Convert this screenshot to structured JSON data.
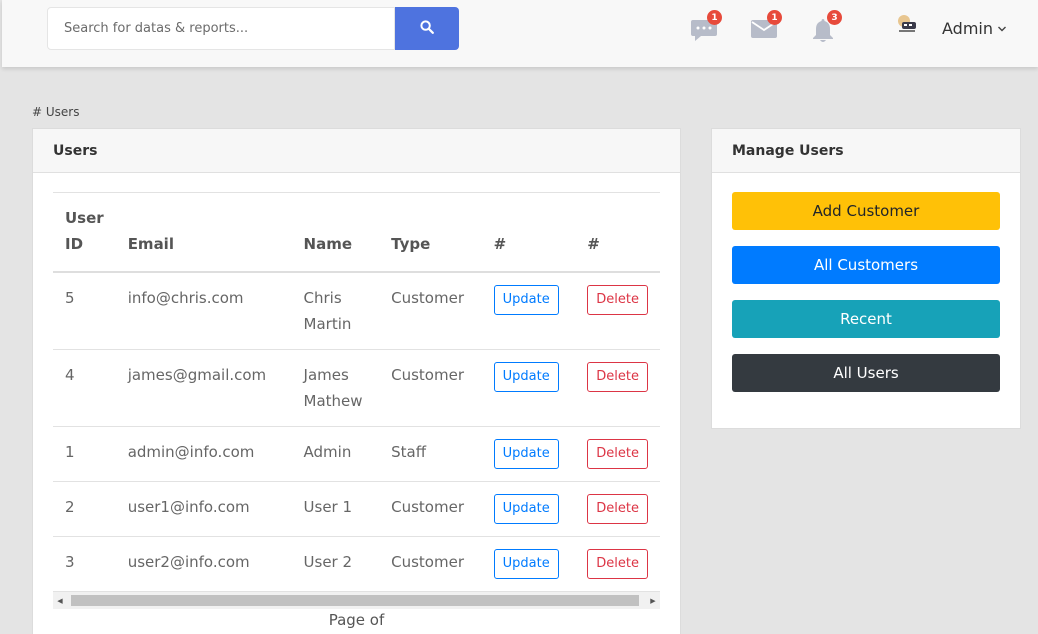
{
  "topbar": {
    "search_placeholder": "Search for datas & reports...",
    "messages_count": "1",
    "mail_count": "1",
    "alerts_count": "3",
    "user_name": "Admin"
  },
  "breadcrumb": "# Users",
  "users_card": {
    "title": "Users",
    "columns": [
      "User ID",
      "Email",
      "Name",
      "Type",
      "#",
      "#"
    ],
    "rows": [
      {
        "id": "5",
        "email": "info@chris.com",
        "name": "Chris Martin",
        "type": "Customer",
        "update": "Update",
        "delete": "Delete"
      },
      {
        "id": "4",
        "email": "james@gmail.com",
        "name": "James Mathew",
        "type": "Customer",
        "update": "Update",
        "delete": "Delete"
      },
      {
        "id": "1",
        "email": "admin@info.com",
        "name": "Admin",
        "type": "Staff",
        "update": "Update",
        "delete": "Delete"
      },
      {
        "id": "2",
        "email": "user1@info.com",
        "name": "User 1",
        "type": "Customer",
        "update": "Update",
        "delete": "Delete"
      },
      {
        "id": "3",
        "email": "user2@info.com",
        "name": "User 2",
        "type": "Customer",
        "update": "Update",
        "delete": "Delete"
      }
    ],
    "pager": "Page of"
  },
  "manage_card": {
    "title": "Manage Users",
    "buttons": [
      {
        "label": "Add Customer",
        "color": "#ffc107",
        "text_color": "#212529"
      },
      {
        "label": "All Customers",
        "color": "#007bff",
        "text_color": "#ffffff"
      },
      {
        "label": "Recent",
        "color": "#17a2b8",
        "text_color": "#ffffff"
      },
      {
        "label": "All Users",
        "color": "#343a40",
        "text_color": "#ffffff"
      }
    ]
  },
  "colors": {
    "primary": "#4e73df",
    "badge": "#e74a3b",
    "icon_gray": "#b7bcc9"
  }
}
